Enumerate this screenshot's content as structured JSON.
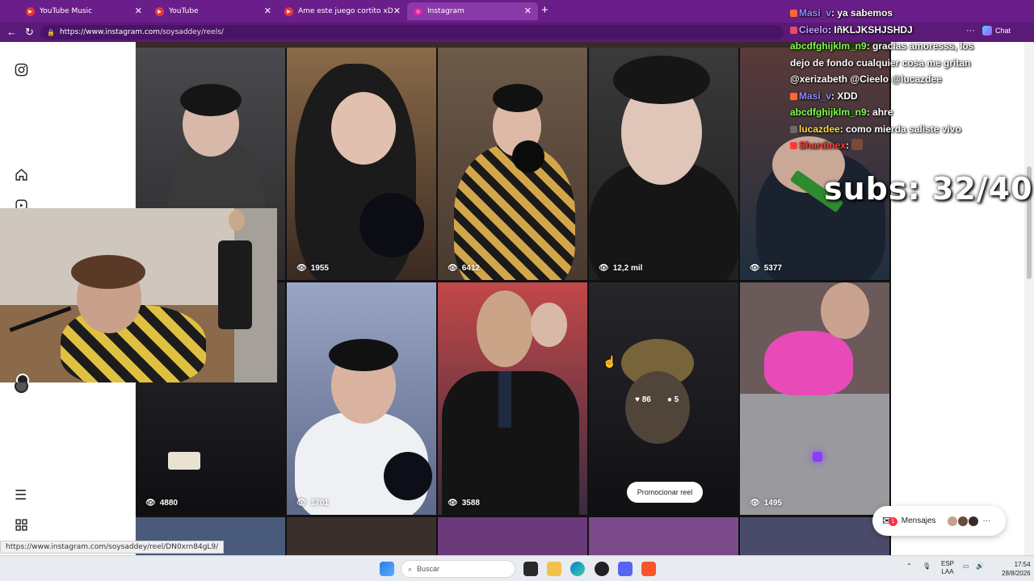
{
  "browser": {
    "tabs": [
      {
        "label": "YouTube Music",
        "color": "#e53935"
      },
      {
        "label": "YouTube",
        "color": "#e53935"
      },
      {
        "label": "Ame este juego cortito xDD Juegos",
        "color": "#e53935"
      },
      {
        "label": "Instagram",
        "color": "#d6249f"
      }
    ],
    "url_host": "https://www.instagram.com",
    "url_path": "/soysaddey/reels/",
    "chat_label": "Chat"
  },
  "reels": [
    {
      "views": ""
    },
    {
      "views": "1955"
    },
    {
      "views": "6412"
    },
    {
      "views": "12,2 mil"
    },
    {
      "views": "5377"
    },
    {
      "views": "4880"
    },
    {
      "views": "1701"
    },
    {
      "views": "3588"
    },
    {
      "views": ""
    },
    {
      "views": "1495"
    }
  ],
  "hovered_reel": {
    "likes": "86",
    "comments": "5",
    "promote_label": "Promocionar reel"
  },
  "chat": {
    "lines": [
      {
        "user": "Masi_v",
        "user_color": "#8e8bff",
        "text": "ya sabemos"
      },
      {
        "user": "Cieelo",
        "user_color": "#c9a0ff",
        "text": "IñKLJKSHJSHDJ"
      },
      {
        "user": "abcdfghijklm_n9",
        "user_color": "#7dff4a",
        "text": "gracias amoresss, los"
      },
      {
        "user": "",
        "user_color": "#ffffff",
        "text": "dejo de fondo cualquier cosa me gritan"
      },
      {
        "user": "",
        "user_color": "#ffffff",
        "text": "@xerizabeth @Cieelo @lucazdee"
      },
      {
        "user": "Masi_v",
        "user_color": "#8e8bff",
        "text": "XDD"
      },
      {
        "user": "abcdfghijklm_n9",
        "user_color": "#7dff4a",
        "text": "ahre"
      },
      {
        "user": "lucazdee",
        "user_color": "#ffd84a",
        "text": "como mierda saliste vivo"
      },
      {
        "user": "Shardinex",
        "user_color": "#ff3b3b",
        "text": ""
      }
    ],
    "subs": "subs: 32/40"
  },
  "messages": {
    "label": "Mensajes",
    "badge": "1"
  },
  "status_url": "https://www.instagram.com/soysaddey/reel/DN0xrn84gL9/",
  "taskbar": {
    "search_placeholder": "Buscar",
    "lang": "ESP",
    "lang2": "LAA",
    "time": "17:54",
    "date": "28/8/2026"
  }
}
